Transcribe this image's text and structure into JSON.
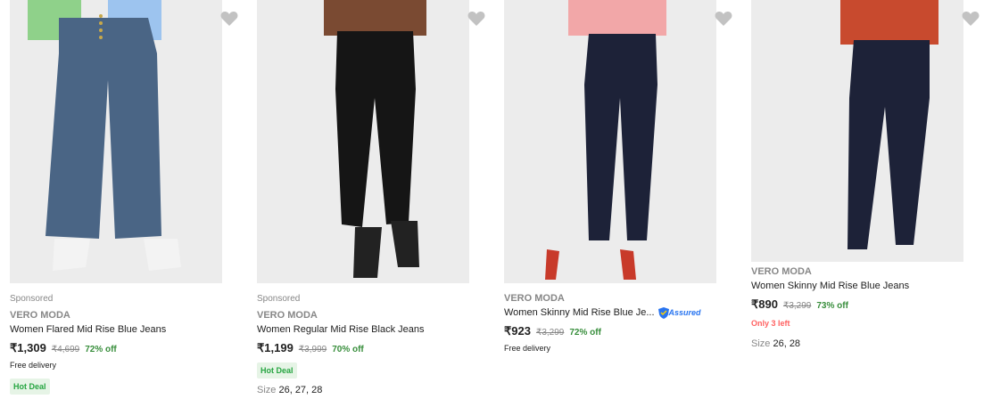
{
  "products": [
    {
      "sponsored": "Sponsored",
      "brand": "VERO MODA",
      "title": "Women Flared Mid Rise Blue Jeans",
      "price": "₹1,309",
      "mrp": "₹4,699",
      "discount": "72% off",
      "delivery": "Free delivery",
      "deal": "Hot Deal",
      "jeans_color": "#4a6585",
      "top_color": "#8fd18a"
    },
    {
      "sponsored": "Sponsored",
      "brand": "VERO MODA",
      "title": "Women Regular Mid Rise Black Jeans",
      "price": "₹1,199",
      "mrp": "₹3,999",
      "discount": "70% off",
      "deal": "Hot Deal",
      "size_label": "Size",
      "sizes": "26, 27, 28",
      "jeans_color": "#151515",
      "top_color": "#7a4a32"
    },
    {
      "brand": "VERO MODA",
      "title": "Women Skinny Mid Rise Blue Je...",
      "assured": "Assured",
      "price": "₹923",
      "mrp": "₹3,299",
      "discount": "72% off",
      "delivery": "Free delivery",
      "jeans_color": "#1d2238",
      "top_color": "#f2a7a8"
    },
    {
      "brand": "VERO MODA",
      "title": "Women Skinny Mid Rise Blue Jeans",
      "price": "₹890",
      "mrp": "₹3,299",
      "discount": "73% off",
      "stock": "Only 3 left",
      "size_label": "Size",
      "sizes": "26, 28",
      "jeans_color": "#1d2238",
      "top_color": "#c84a2e"
    }
  ]
}
